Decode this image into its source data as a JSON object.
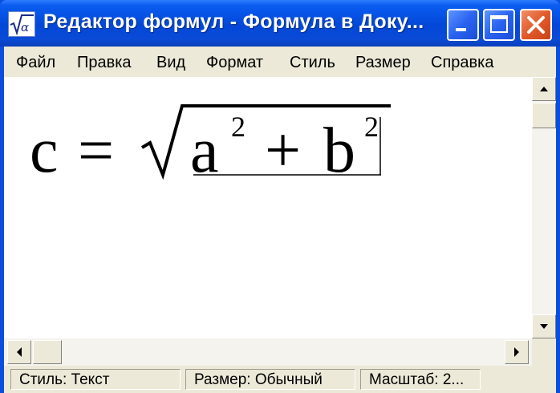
{
  "window": {
    "title": "Редактор формул - Формула в Доку...",
    "app_icon_glyph": "√α"
  },
  "titlebar_buttons": {
    "minimize": "minimize-icon",
    "maximize": "maximize-icon",
    "close": "close-icon"
  },
  "menu": {
    "items": [
      "Файл",
      "Правка",
      "Вид",
      "Формат",
      "Стиль",
      "Размер",
      "Справка"
    ]
  },
  "formula": {
    "lhs": "c",
    "equals": "=",
    "radicand_a": "a",
    "exp_a": "2",
    "plus": "+",
    "radicand_b": "b",
    "exp_b": "2"
  },
  "status": {
    "style": "Стиль: Текст",
    "size": "Размер: Обычный",
    "zoom": "Масштаб: 2..."
  },
  "colors": {
    "titlebar": "#0a4ee0",
    "menubar": "#ece9d8",
    "close_button": "#e25a2a"
  }
}
